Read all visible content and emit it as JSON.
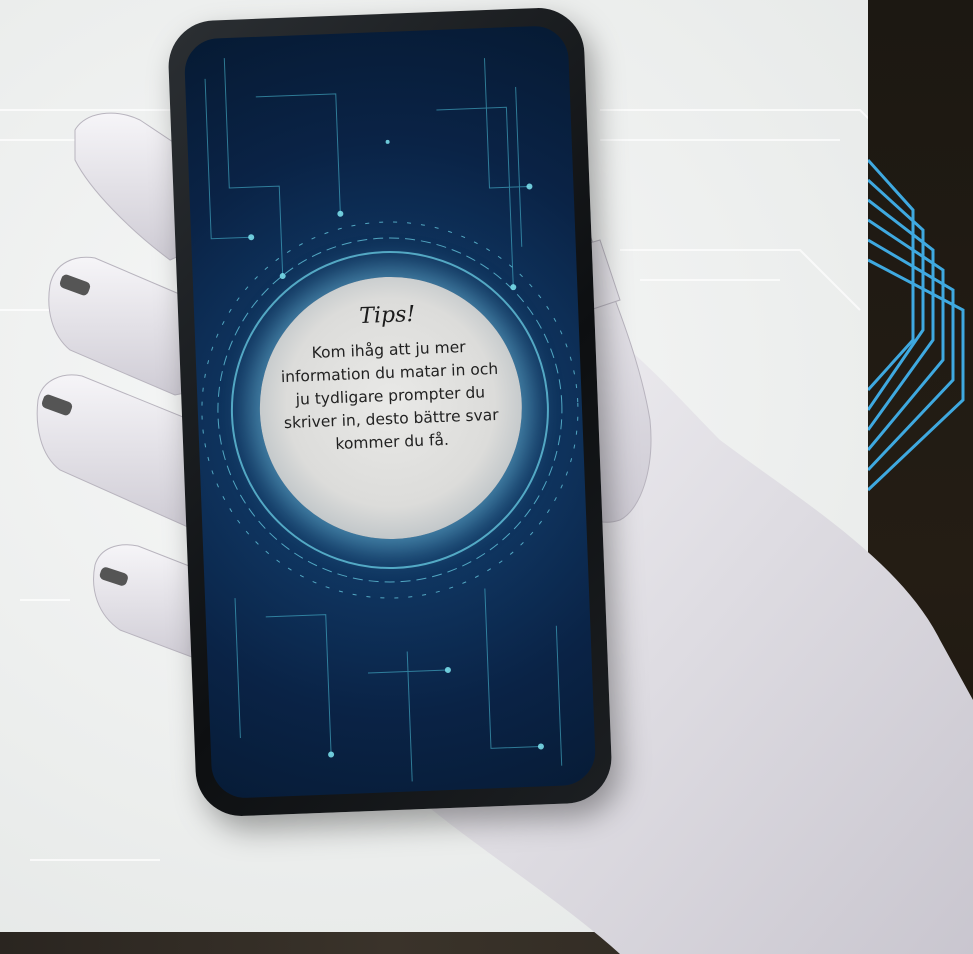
{
  "tip": {
    "title": "Tips!",
    "body": "Kom ihåg att ju mer information du matar in och ju tydligare prompter du skriver in, desto bättre svar kommer du få."
  },
  "colors": {
    "background": "#eef0ef",
    "screen": "#0f3560",
    "glow": "#5fd3e6",
    "bubble": "#dcdcda",
    "robot_hand": "#e8e6ea",
    "dark_panel": "#1f1a13"
  },
  "icons": [
    "robot-hand-icon",
    "smartphone-icon",
    "circuit-pattern-icon"
  ]
}
